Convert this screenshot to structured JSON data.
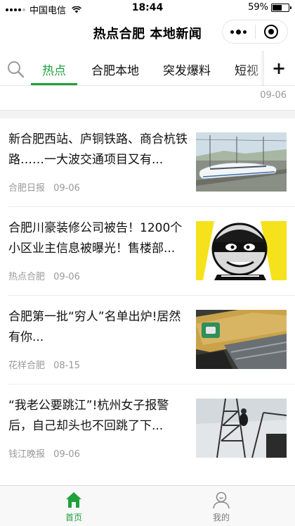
{
  "status_bar": {
    "carrier": "中国电信",
    "time": "18:44",
    "battery": "59%",
    "battery_level": 0.59
  },
  "navbar": {
    "title": "热点合肥 本地新闻"
  },
  "tabs": {
    "items": [
      {
        "label": "热点",
        "active": true
      },
      {
        "label": "合肥本地",
        "active": false
      },
      {
        "label": "突发爆料",
        "active": false
      },
      {
        "label": "短视",
        "active": false
      }
    ],
    "add_label": "+"
  },
  "previous_item": {
    "date": "09-06"
  },
  "articles": [
    {
      "title": "新合肥西站、庐铜铁路、商合杭铁路……一大波交通项目又有...",
      "source": "合肥日报",
      "date": "09-06",
      "thumb_icon": "train-photo"
    },
    {
      "title": "合肥川豪装修公司被告！1200个小区业主信息被曝光！售楼部...",
      "source": "热点合肥",
      "date": "09-06",
      "thumb_icon": "thief-cartoon"
    },
    {
      "title": "合肥第一批“穷人”名单出炉!居然有你...",
      "source": "花样合肥",
      "date": "08-15",
      "thumb_icon": "bank-cards-photo"
    },
    {
      "title": "“我老公要跳江”!杭州女子报警后，自己却头也不回跳了下...",
      "source": "钱江晚报",
      "date": "09-06",
      "thumb_icon": "tower-climber-photo"
    }
  ],
  "tabbar": {
    "home_label": "首页",
    "me_label": "我的"
  },
  "colors": {
    "accent": "#1ea13a",
    "meta": "#999999",
    "tabbar_bg": "#f8f8f8"
  }
}
